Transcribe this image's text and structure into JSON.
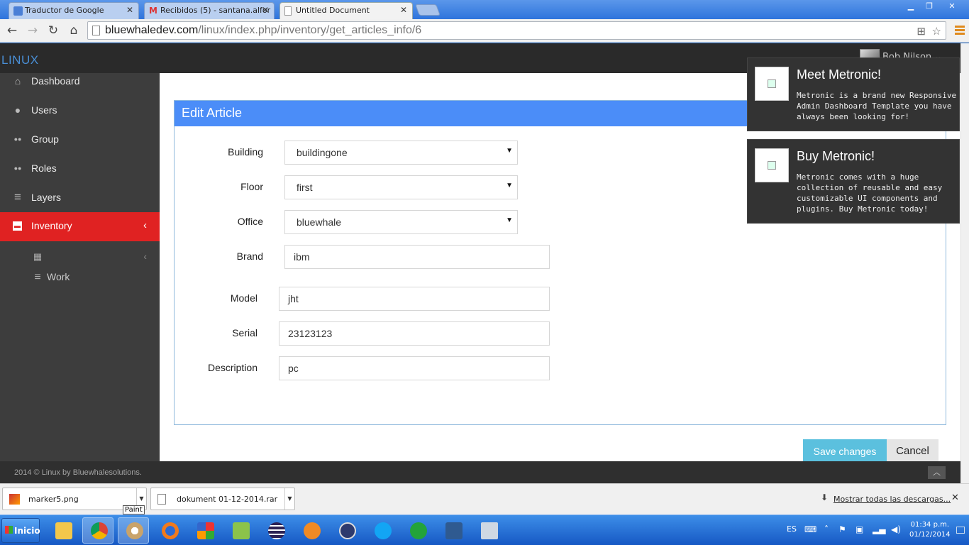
{
  "browser": {
    "tabs": [
      {
        "title": "Traductor de Google",
        "icon": "google-translate-icon"
      },
      {
        "title": "Recibidos (5) - santana.alfor",
        "icon": "gmail-icon"
      },
      {
        "title": "Untitled Document",
        "icon": "page-icon"
      }
    ],
    "url_host": "bluewhaledev.com",
    "url_path": "/linux/index.php/inventory/get_articles_info/6"
  },
  "header": {
    "logo": "LINUX",
    "user_name": "Bob Nilson"
  },
  "sidebar": {
    "items": [
      {
        "label": "Dashboard",
        "icon": "home-icon",
        "glyph": "⌂"
      },
      {
        "label": "Users",
        "icon": "user-icon",
        "glyph": "●"
      },
      {
        "label": "Group",
        "icon": "group-icon",
        "glyph": "●●"
      },
      {
        "label": "Roles",
        "icon": "roles-icon",
        "glyph": "●●"
      },
      {
        "label": "Layers",
        "icon": "list-icon",
        "glyph": "≡"
      },
      {
        "label": "Inventory",
        "icon": "inventory-icon",
        "glyph": "▬",
        "arrow": "‹"
      }
    ],
    "sub_items": [
      {
        "label": "",
        "icon": "building-icon",
        "glyph": "▦",
        "arrow": "‹"
      },
      {
        "label": "Work",
        "icon": "list-icon",
        "glyph": "≡"
      }
    ]
  },
  "form": {
    "title": "Edit Article",
    "fields": {
      "building": {
        "label": "Building",
        "value": "buildingone"
      },
      "floor": {
        "label": "Floor",
        "value": "first"
      },
      "office": {
        "label": "Office",
        "value": "bluewhale"
      },
      "brand": {
        "label": "Brand",
        "value": "ibm"
      },
      "model": {
        "label": "Model",
        "value": "jht"
      },
      "serial": {
        "label": "Serial",
        "value": "23123123"
      },
      "description": {
        "label": "Description",
        "value": "pc"
      }
    },
    "save_label": "Save changes",
    "cancel_label": "Cancel"
  },
  "footer": {
    "text": "2014 © Linux by Bluewhalesolutions."
  },
  "notifications": [
    {
      "title": "Meet Metronic!",
      "text": "Metronic is a brand new Responsive Admin Dashboard Template you have always been looking for!"
    },
    {
      "title": "Buy Metronic!",
      "text": "Metronic comes with a huge collection of reusable and easy customizable UI components and plugins. Buy Metronic today!"
    }
  ],
  "downloads": {
    "items": [
      {
        "name": "marker5.png"
      },
      {
        "name": "dokument 01-12-2014.rar"
      }
    ],
    "show_all": "Mostrar todas las descargas...",
    "tooltip": "Paint"
  },
  "taskbar": {
    "start_label": "Inicio",
    "language": "ES",
    "time": "01:34 p.m.",
    "date": "01/12/2014"
  },
  "colors": {
    "accent_blue": "#4b8df8",
    "active_red": "#e02222",
    "save_button": "#5bc0de"
  }
}
